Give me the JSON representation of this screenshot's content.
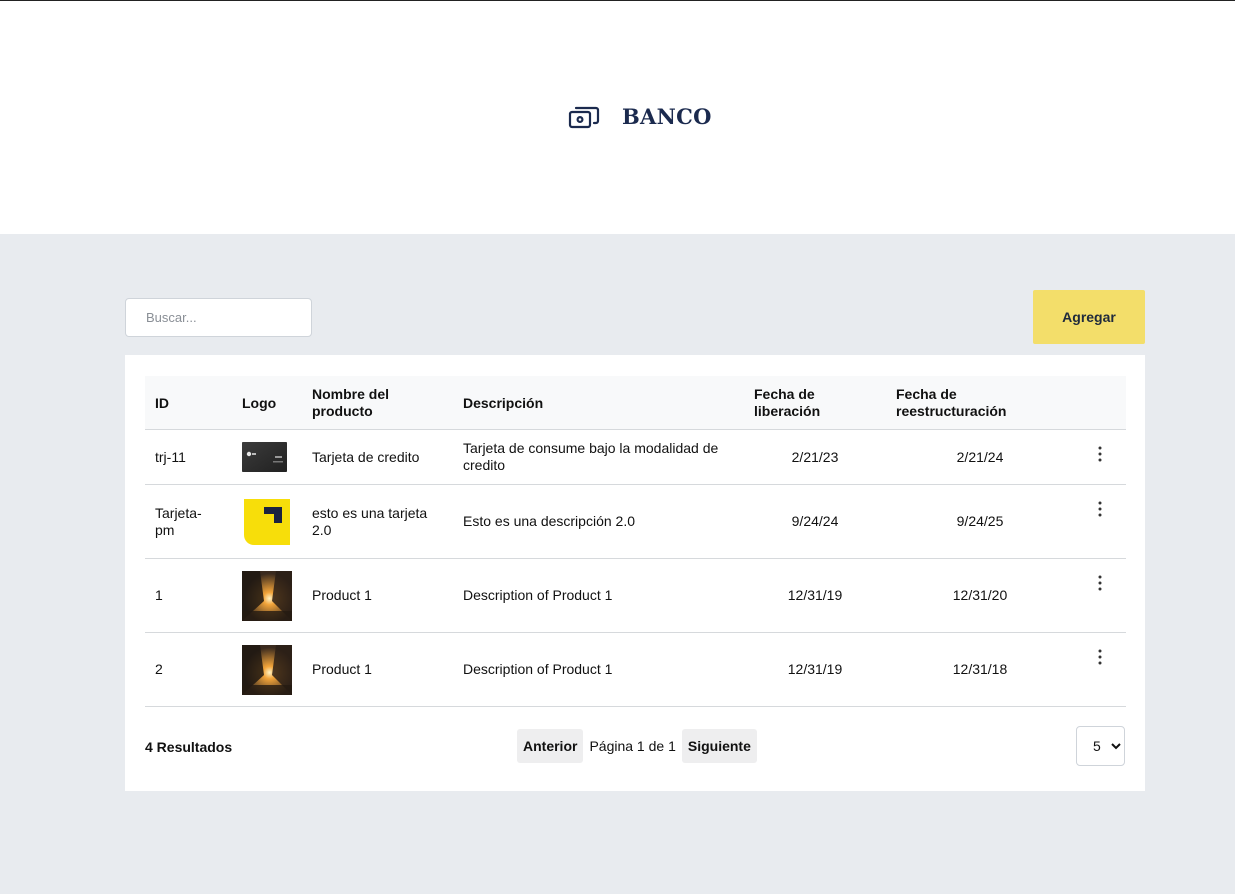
{
  "brand": {
    "name": "BANCO",
    "icon": "banknote-icon",
    "color": "#1b2a4e"
  },
  "search": {
    "placeholder": "Buscar...",
    "value": ""
  },
  "actions": {
    "add_label": "Agregar",
    "accent": "#f3de6a"
  },
  "table": {
    "headers": {
      "id": "ID",
      "logo": "Logo",
      "name": "Nombre del producto",
      "description": "Descripción",
      "release": "Fecha de liberación",
      "restructure": "Fecha de reestructuración"
    },
    "rows": [
      {
        "id": "trj-11",
        "logo": "card-thumbnail",
        "name": "Tarjeta de credito",
        "description": "Tarjeta de consume bajo la modalidad de credito",
        "release": "2/21/23",
        "restructure": "2/21/24"
      },
      {
        "id": "Tarjeta-pm",
        "logo": "yellow-logo-thumbnail",
        "name": "esto es una tarjeta 2.0",
        "description": "Esto es una descripción 2.0",
        "release": "9/24/24",
        "restructure": "9/24/25"
      },
      {
        "id": "1",
        "logo": "street-sunset-photo",
        "name": "Product 1",
        "description": "Description of Product 1",
        "release": "12/31/19",
        "restructure": "12/31/20"
      },
      {
        "id": "2",
        "logo": "street-sunset-photo",
        "name": "Product 1",
        "description": "Description of Product 1",
        "release": "12/31/19",
        "restructure": "12/31/18"
      }
    ]
  },
  "footer": {
    "results": "4 Resultados",
    "prev_label": "Anterior",
    "page_text": "Página 1 de 1",
    "next_label": "Siguiente",
    "page_size": "5",
    "page_size_options": [
      "5"
    ]
  }
}
